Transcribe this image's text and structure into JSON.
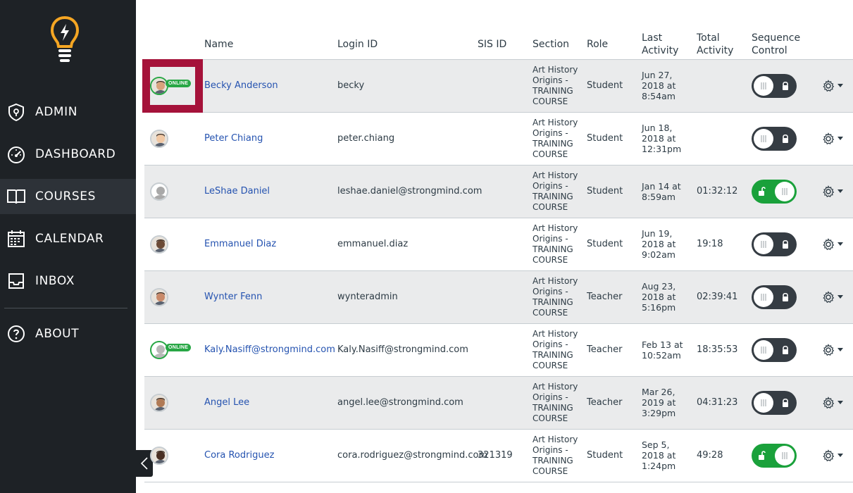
{
  "sidebar": {
    "items": [
      {
        "label": "ADMIN",
        "icon": "admin-shield-icon"
      },
      {
        "label": "DASHBOARD",
        "icon": "speedometer-icon"
      },
      {
        "label": "COURSES",
        "icon": "book-icon"
      },
      {
        "label": "CALENDAR",
        "icon": "calendar-icon"
      },
      {
        "label": "INBOX",
        "icon": "inbox-tray-icon"
      },
      {
        "label": "ABOUT",
        "icon": "question-circle-icon"
      }
    ],
    "active": "COURSES"
  },
  "table": {
    "headers": {
      "name": "Name",
      "login_id": "Login ID",
      "sis_id": "SIS ID",
      "section": "Section",
      "role": "Role",
      "last_activity_1": "Last",
      "last_activity_2": "Activity",
      "total_activity_1": "Total",
      "total_activity_2": "Activity",
      "sequence_control_1": "Sequence",
      "sequence_control_2": "Control"
    },
    "online_label": "ONLINE",
    "rows": [
      {
        "name": "Becky Anderson",
        "login_id": "becky",
        "sis_id": "",
        "section": [
          "Art History",
          "Origins -",
          "TRAINING",
          "COURSE"
        ],
        "role": "Student",
        "last_activity": [
          "Jun 27,",
          "2018 at",
          "8:54am"
        ],
        "total_activity": "",
        "sequence_on": false,
        "online": true
      },
      {
        "name": "Peter Chiang",
        "login_id": "peter.chiang",
        "sis_id": "",
        "section": [
          "Art History",
          "Origins -",
          "TRAINING",
          "COURSE"
        ],
        "role": "Student",
        "last_activity": [
          "Jun 18,",
          "2018 at",
          "12:31pm"
        ],
        "total_activity": "",
        "sequence_on": false,
        "online": false
      },
      {
        "name": "LeShae Daniel",
        "login_id": "leshae.daniel@strongmind.com",
        "sis_id": "",
        "section": [
          "Art History",
          "Origins -",
          "TRAINING",
          "COURSE"
        ],
        "role": "Student",
        "last_activity": [
          "Jan 14 at",
          "8:59am"
        ],
        "total_activity": "01:32:12",
        "sequence_on": true,
        "online": false
      },
      {
        "name": "Emmanuel Diaz",
        "login_id": "emmanuel.diaz",
        "sis_id": "",
        "section": [
          "Art History",
          "Origins -",
          "TRAINING",
          "COURSE"
        ],
        "role": "Student",
        "last_activity": [
          "Jun 19,",
          "2018 at",
          "9:02am"
        ],
        "total_activity": "19:18",
        "sequence_on": false,
        "online": false
      },
      {
        "name": "Wynter Fenn",
        "login_id": "wynteradmin",
        "sis_id": "",
        "section": [
          "Art History",
          "Origins -",
          "TRAINING",
          "COURSE"
        ],
        "role": "Teacher",
        "last_activity": [
          "Aug 23,",
          "2018 at",
          "5:16pm"
        ],
        "total_activity": "02:39:41",
        "sequence_on": false,
        "online": false
      },
      {
        "name": "Kaly.Nasiff@strongmind.com",
        "login_id": "Kaly.Nasiff@strongmind.com",
        "sis_id": "",
        "section": [
          "Art History",
          "Origins -",
          "TRAINING",
          "COURSE"
        ],
        "role": "Teacher",
        "last_activity": [
          "Feb 13 at",
          "10:52am"
        ],
        "total_activity": "18:35:53",
        "sequence_on": false,
        "online": true
      },
      {
        "name": "Angel Lee",
        "login_id": "angel.lee@strongmind.com",
        "sis_id": "",
        "section": [
          "Art History",
          "Origins -",
          "TRAINING",
          "COURSE"
        ],
        "role": "Teacher",
        "last_activity": [
          "Mar 26,",
          "2019 at",
          "3:29pm"
        ],
        "total_activity": "04:31:23",
        "sequence_on": false,
        "online": false
      },
      {
        "name": "Cora Rodriguez",
        "login_id": "cora.rodriguez@strongmind.com",
        "sis_id": "321319",
        "section": [
          "Art History",
          "Origins -",
          "TRAINING",
          "COURSE"
        ],
        "role": "Student",
        "last_activity": [
          "Sep 5,",
          "2018 at",
          "1:24pm"
        ],
        "total_activity": "49:28",
        "sequence_on": true,
        "online": false
      }
    ]
  },
  "colors": {
    "sidebar_bg": "#1e2226",
    "link": "#2553b0",
    "toggle_off": "#353c43",
    "toggle_on": "#1aa13b",
    "online_badge": "#28a745",
    "highlight": "#a5123a",
    "logo": "#f5a623"
  }
}
